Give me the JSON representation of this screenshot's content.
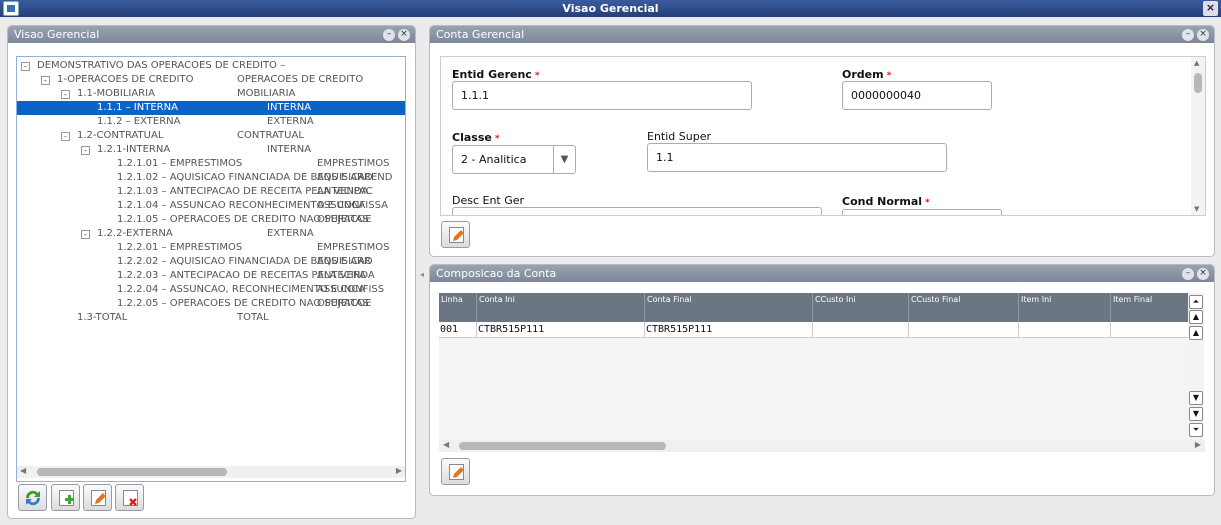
{
  "window": {
    "title": "Visao Gerencial",
    "close_glyph": "×"
  },
  "left_panel": {
    "title": "Visao Gerencial",
    "tree": [
      {
        "level": 0,
        "expander": "⊟",
        "code": "DEMONSTRATIVO DAS OPERACOES DE CREDITO –",
        "desc": ""
      },
      {
        "level": 1,
        "expander": "⊟",
        "code": "1-OPERACOES DE CREDITO",
        "desc": "OPERACOES DE CREDITO"
      },
      {
        "level": 2,
        "expander": "⊟",
        "code": "1.1-MOBILIARIA",
        "desc": "MOBILIARIA"
      },
      {
        "level": 3,
        "expander": "",
        "code": "1.1.1 – INTERNA",
        "desc": "INTERNA",
        "selected": true
      },
      {
        "level": 3,
        "expander": "",
        "code": "1.1.2 – EXTERNA",
        "desc": "EXTERNA"
      },
      {
        "level": 2,
        "expander": "⊟",
        "code": "1.2-CONTRATUAL",
        "desc": "CONTRATUAL"
      },
      {
        "level": 3,
        "expander": "⊟",
        "code": "1.2.1-INTERNA",
        "desc": "INTERNA"
      },
      {
        "level": 4,
        "expander": "",
        "code": "1.2.1.01 – EMPRESTIMOS",
        "desc": "EMPRESTIMOS"
      },
      {
        "level": 4,
        "expander": "",
        "code": "1.2.1.02 – AQUISICAO FINANCIADA DE BENS E ARREND",
        "desc": "AQUISICAO"
      },
      {
        "level": 4,
        "expander": "",
        "code": "1.2.1.03 – ANTECIPACAO DE RECEITA PELA VENDA",
        "desc": "ANTECIPAC"
      },
      {
        "level": 4,
        "expander": "",
        "code": "1.2.1.04 – ASSUNCAO RECONHECIMENTO E CONFISSA",
        "desc": "ASSUNCA"
      },
      {
        "level": 4,
        "expander": "",
        "code": "1.2.1.05 – OPERACOES DE CREDITO NAO SUJEITAS",
        "desc": "OPERACOE"
      },
      {
        "level": 3,
        "expander": "⊟",
        "code": "1.2.2-EXTERNA",
        "desc": "EXTERNA"
      },
      {
        "level": 4,
        "expander": "",
        "code": "1.2.2.01 – EMPRESTIMOS",
        "desc": "EMPRESTIMOS"
      },
      {
        "level": 4,
        "expander": "",
        "code": "1.2.2.02 – AQUISICAO FINANCIADA DE BENS E ARR",
        "desc": "AQUISICAO"
      },
      {
        "level": 4,
        "expander": "",
        "code": "1.2.2.03 – ANTECIPACAO DE RECEITAS PELA VENDA",
        "desc": "ANTECIPA"
      },
      {
        "level": 4,
        "expander": "",
        "code": "1.2.2.04 – ASSUNCAO, RECONHECIMENTO E CONFISS",
        "desc": "ASSUNCA"
      },
      {
        "level": 4,
        "expander": "",
        "code": "1.2.2.05 – OPERACOES DE CREDITO NAO SUJEITAS",
        "desc": "OPERACOE"
      },
      {
        "level": 2,
        "expander": "",
        "code": "1.3-TOTAL",
        "desc": "TOTAL"
      }
    ],
    "toolbar": [
      "refresh-icon",
      "add-icon",
      "edit-icon",
      "delete-icon"
    ]
  },
  "conta_panel": {
    "title": "Conta Gerencial",
    "fields": {
      "entid_label": "Entid Gerenc",
      "entid_value": "1.1.1",
      "ordem_label": "Ordem",
      "ordem_value": "0000000040",
      "classe_label": "Classe",
      "classe_value": "2 - Analitica",
      "super_label": "Entid Super",
      "super_value": "1.1",
      "desc_label": "Desc Ent Ger",
      "desc_value": "",
      "cond_label": "Cond Normal",
      "cond_value": "",
      "required_mark": "*"
    }
  },
  "comp_panel": {
    "title": "Composicao da Conta",
    "columns": [
      "Linha",
      "Conta Ini",
      "Conta Final",
      "CCusto Ini",
      "CCusto Final",
      "Item Ini",
      "Item Final"
    ],
    "rows": [
      [
        "001",
        "CTBR515P111",
        "CTBR515P111",
        "",
        "",
        "",
        ""
      ]
    ]
  },
  "colors": {
    "selection": "#0a64c8",
    "title_bar": "#2f4f8f",
    "panel_header": "#8a93a3",
    "required": "#e11111"
  }
}
